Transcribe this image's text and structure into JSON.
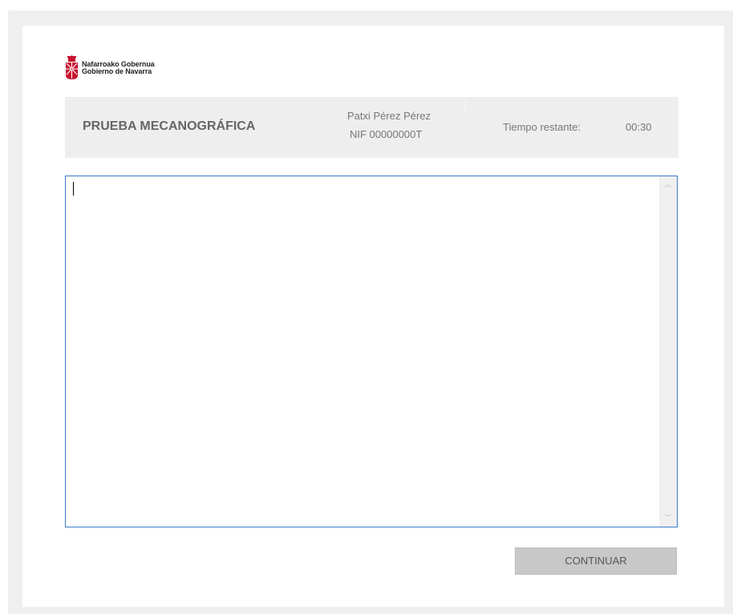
{
  "logo": {
    "line1": "Nafarroako Gobernua",
    "line2": "Gobierno de Navarra",
    "color": "#c8102e"
  },
  "header": {
    "title": "PRUEBA MECANOGRÁFICA",
    "user_name": "Patxi Pérez Pérez",
    "user_nif": "NIF 00000000T",
    "time_label": "Tiempo restante:",
    "time_value": "00:30"
  },
  "editor": {
    "value": "",
    "border_color": "#3b7cc9"
  },
  "actions": {
    "continue_label": "CONTINUAR"
  }
}
